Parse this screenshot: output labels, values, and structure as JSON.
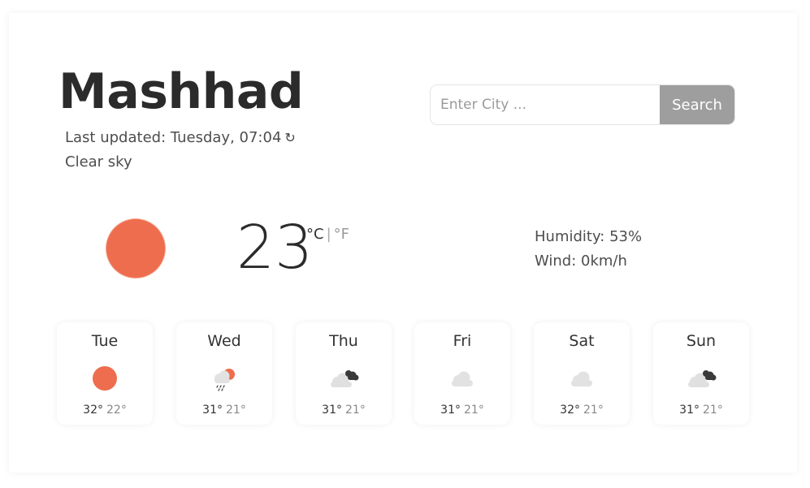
{
  "city": "Mashhad",
  "last_updated": "Last updated: Tuesday, 07:04",
  "refresh_symbol": "↻",
  "description": "Clear sky",
  "search": {
    "placeholder": "Enter City ...",
    "button_label": "Search"
  },
  "current": {
    "temperature": "23",
    "unit_c": "°C",
    "unit_sep": "|",
    "unit_f": "°F",
    "icon": "sun-icon",
    "humidity": "Humidity: 53%",
    "wind": "Wind: 0km/h"
  },
  "colors": {
    "sun": "#ee6d4e",
    "search_button": "#9e9e9e"
  },
  "forecast": [
    {
      "day": "Tue",
      "icon": "sun-icon",
      "high": "32°",
      "low": "22°"
    },
    {
      "day": "Wed",
      "icon": "rain-sun-icon",
      "high": "31°",
      "low": "21°"
    },
    {
      "day": "Thu",
      "icon": "broken-clouds-icon",
      "high": "31°",
      "low": "21°"
    },
    {
      "day": "Fri",
      "icon": "cloud-icon",
      "high": "31°",
      "low": "21°"
    },
    {
      "day": "Sat",
      "icon": "cloud-icon",
      "high": "32°",
      "low": "21°"
    },
    {
      "day": "Sun",
      "icon": "broken-clouds-icon",
      "high": "31°",
      "low": "21°"
    }
  ]
}
